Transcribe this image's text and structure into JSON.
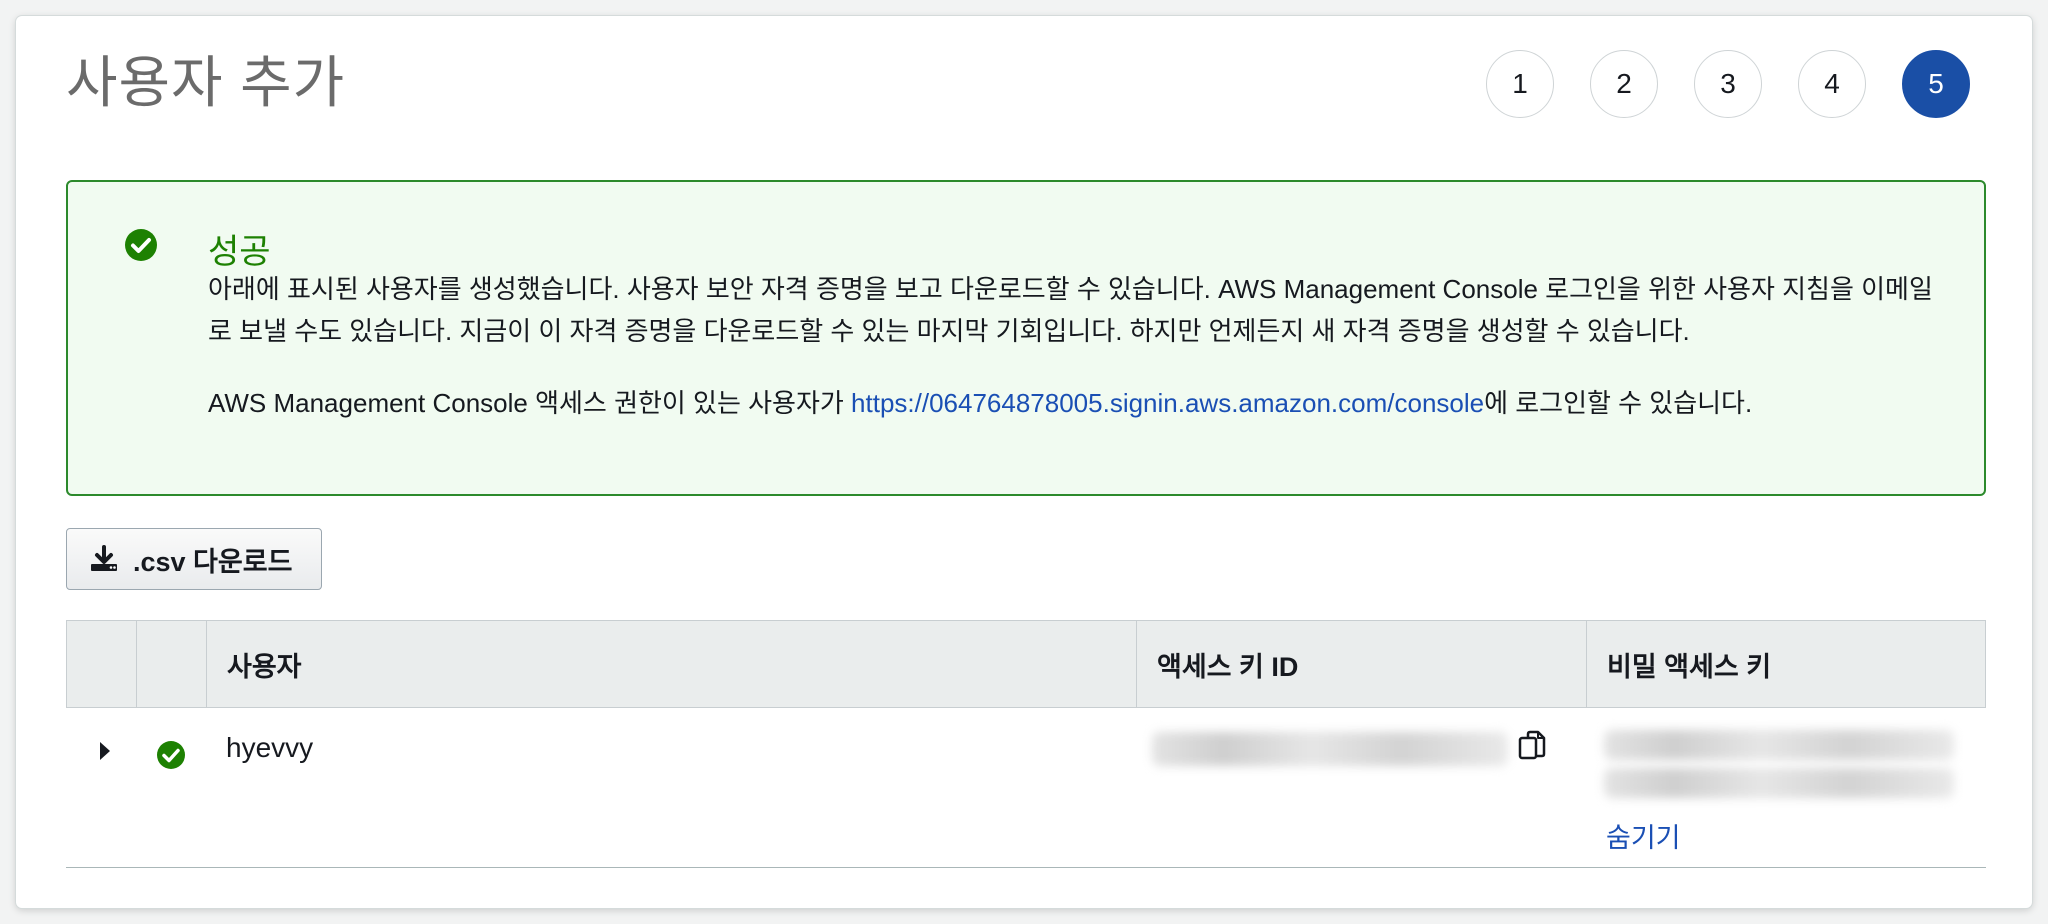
{
  "page": {
    "title": "사용자 추가"
  },
  "steps": [
    "1",
    "2",
    "3",
    "4",
    "5"
  ],
  "active_step": "5",
  "alert": {
    "icon": "check-circle-icon",
    "title": "성공",
    "message_line": "아래에 표시된 사용자를 생성했습니다. 사용자 보안 자격 증명을 보고 다운로드할 수 있습니다. AWS Management Console 로그인을 위한 사용자 지침을 이메일로 보낼 수도 있습니다. 지금이 이 자격 증명을 다운로드할 수 있는 마지막 기회입니다. 하지만 언제든지 새 자격 증명을 생성할 수 있습니다.",
    "console_prefix": "AWS Management Console 액세스 권한이 있는 사용자가 ",
    "console_link": "https://064764878005.signin.aws.amazon.com/console",
    "console_suffix": "에 로그인할 수 있습니다."
  },
  "download_button": {
    "icon": "download-icon",
    "label": ".csv 다운로드"
  },
  "table": {
    "headers": [
      "",
      "",
      "사용자",
      "액세스 키 ID",
      "비밀 액세스 키"
    ],
    "rows": [
      {
        "user": "hyevvy",
        "status_icon": "check-circle-icon",
        "access_key_id_blurred": true,
        "secret_key_blurred": true,
        "hide_label": "숨기기"
      }
    ]
  },
  "colors": {
    "success": "#1d8102",
    "link": "#1a4fb4",
    "active_step": "#1a4fa6",
    "alert_bg": "#f1fbf1",
    "alert_border": "#2c8a2c"
  }
}
